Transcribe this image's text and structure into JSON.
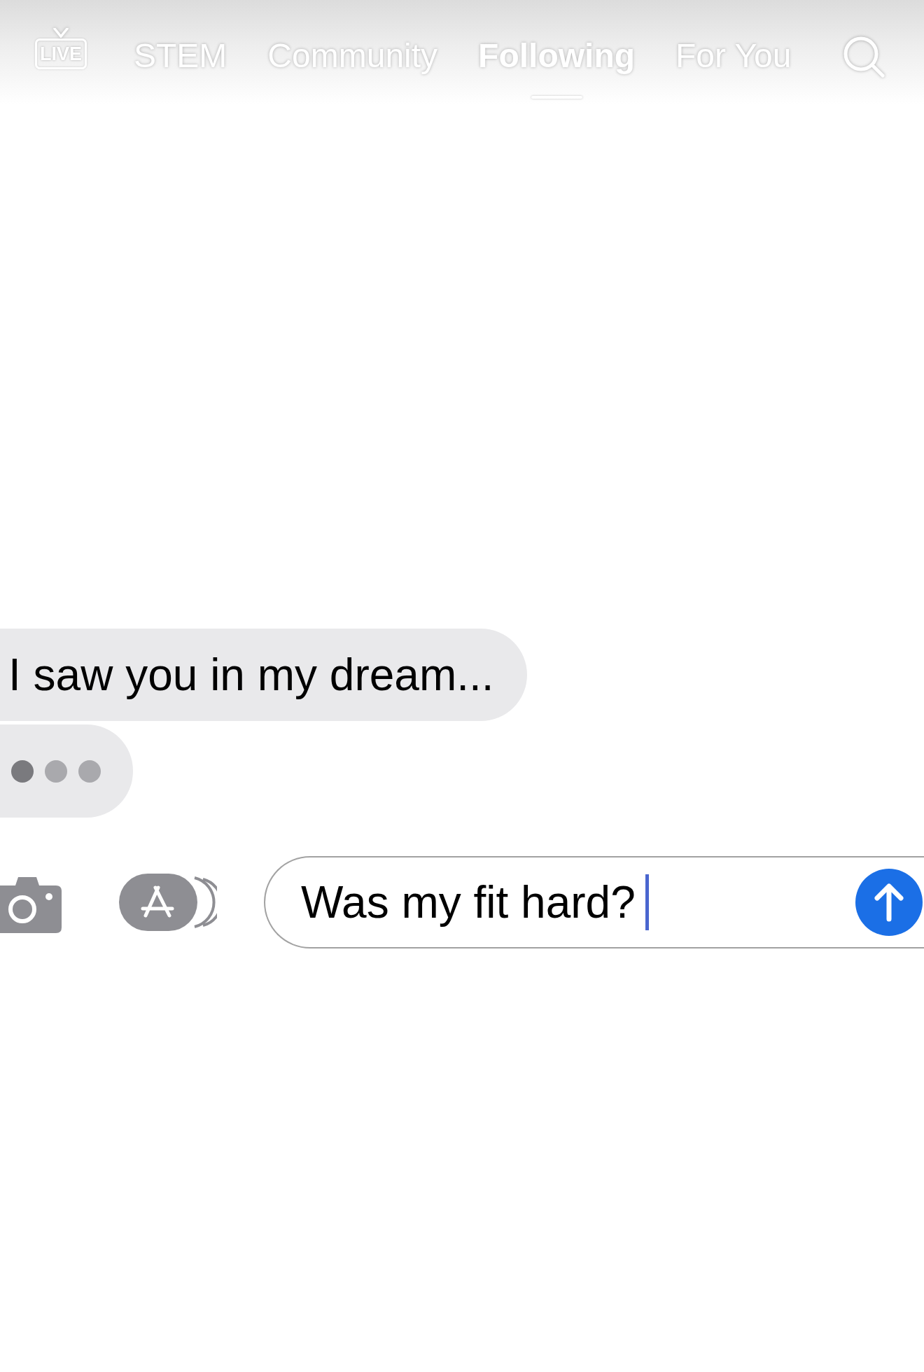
{
  "top_nav": {
    "live_button": {
      "label": "LIVE"
    },
    "tabs": [
      {
        "label": "STEM",
        "selected": false
      },
      {
        "label": "Community",
        "selected": false
      },
      {
        "label": "Following",
        "selected": true
      },
      {
        "label": "For You",
        "selected": false
      }
    ]
  },
  "messages": [
    {
      "kind": "text",
      "text": "I saw you in my dream..."
    },
    {
      "kind": "typing"
    }
  ],
  "composer": {
    "value": "Was my fit hard?"
  }
}
